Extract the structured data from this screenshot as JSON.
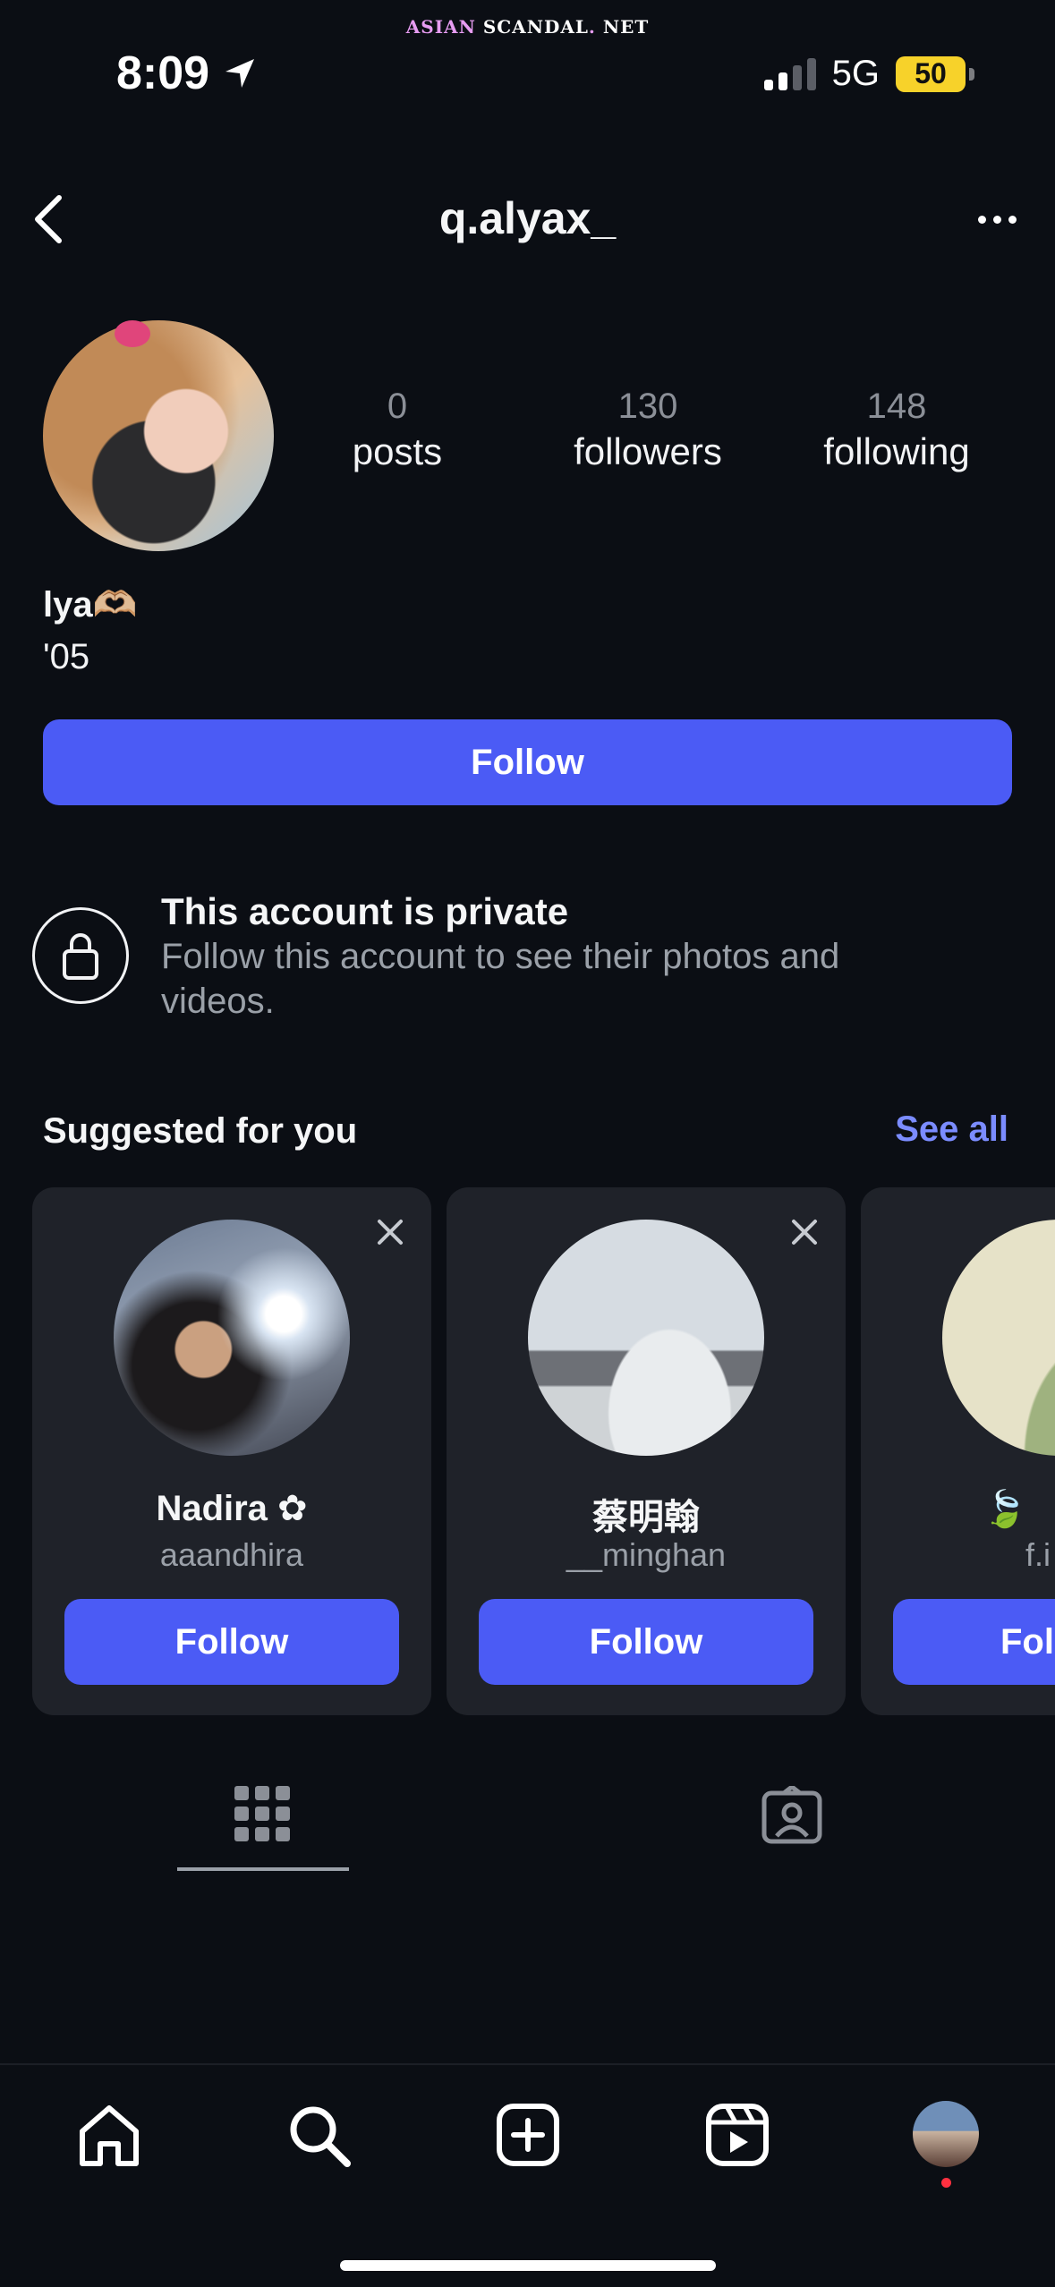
{
  "watermark": {
    "part1": "ASIAN",
    "part2": " SCANDAL",
    "part3": ".",
    "part4": " NET"
  },
  "status_bar": {
    "time": "8:09",
    "network": "5G",
    "battery": "50"
  },
  "header": {
    "username": "q.alyax_"
  },
  "profile": {
    "stats": [
      {
        "value": "0",
        "label": "posts"
      },
      {
        "value": "130",
        "label": "followers"
      },
      {
        "value": "148",
        "label": "following"
      }
    ],
    "display_name": "lya🫶🏼",
    "bio": "'05",
    "follow_label": "Follow"
  },
  "private_notice": {
    "title": "This account is private",
    "subtitle": "Follow this account to see their photos and videos."
  },
  "suggestions": {
    "title": "Suggested for you",
    "see_all": "See all",
    "cards": [
      {
        "name": "Nadira ✿",
        "handle": "aaandhira",
        "button": "Follow"
      },
      {
        "name": "蔡明翰",
        "handle": "__minghan",
        "button": "Follow"
      },
      {
        "name": "🍃",
        "handle": "f.i",
        "button": "Fol"
      }
    ]
  },
  "colors": {
    "accent": "#4b5bf5",
    "link": "#7b8cff",
    "background": "#0b0e14",
    "card": "#1f2229"
  },
  "nav": {
    "items": [
      "home-icon",
      "search-icon",
      "create-icon",
      "reels-icon",
      "profile-avatar"
    ]
  }
}
